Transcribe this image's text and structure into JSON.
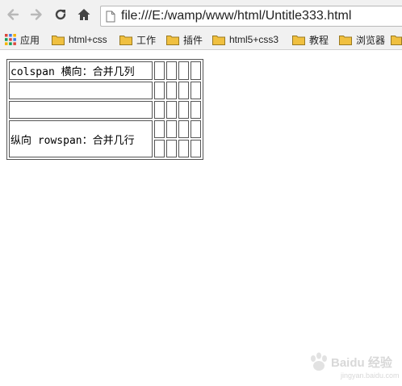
{
  "toolbar": {
    "url": "file:///E:/wamp/www/html/Untitle333.html",
    "icons": [
      "back-icon",
      "forward-icon",
      "reload-icon",
      "home-icon",
      "page-icon"
    ]
  },
  "bookmarks": {
    "items": [
      {
        "label": "应用",
        "icon": "apps-grid-icon"
      },
      {
        "label": "html+css",
        "icon": "folder-icon"
      },
      {
        "label": "工作",
        "icon": "folder-icon"
      },
      {
        "label": "插件",
        "icon": "folder-icon"
      },
      {
        "label": "html5+css3",
        "icon": "folder-icon"
      },
      {
        "label": "教程",
        "icon": "folder-icon"
      },
      {
        "label": "浏览器",
        "icon": "folder-icon"
      }
    ]
  },
  "table": {
    "cells": {
      "colspan_text": "colspan 横向：合并几列",
      "rowspan_text": "纵向 rowspan：合并几行"
    }
  },
  "watermark": {
    "text": "Baidu 经验",
    "sub": "jingyan.baidu.com"
  },
  "colors": {
    "toolbar_bg": "#f1f1f1",
    "border": "#555555",
    "folder": "#f0c040"
  }
}
